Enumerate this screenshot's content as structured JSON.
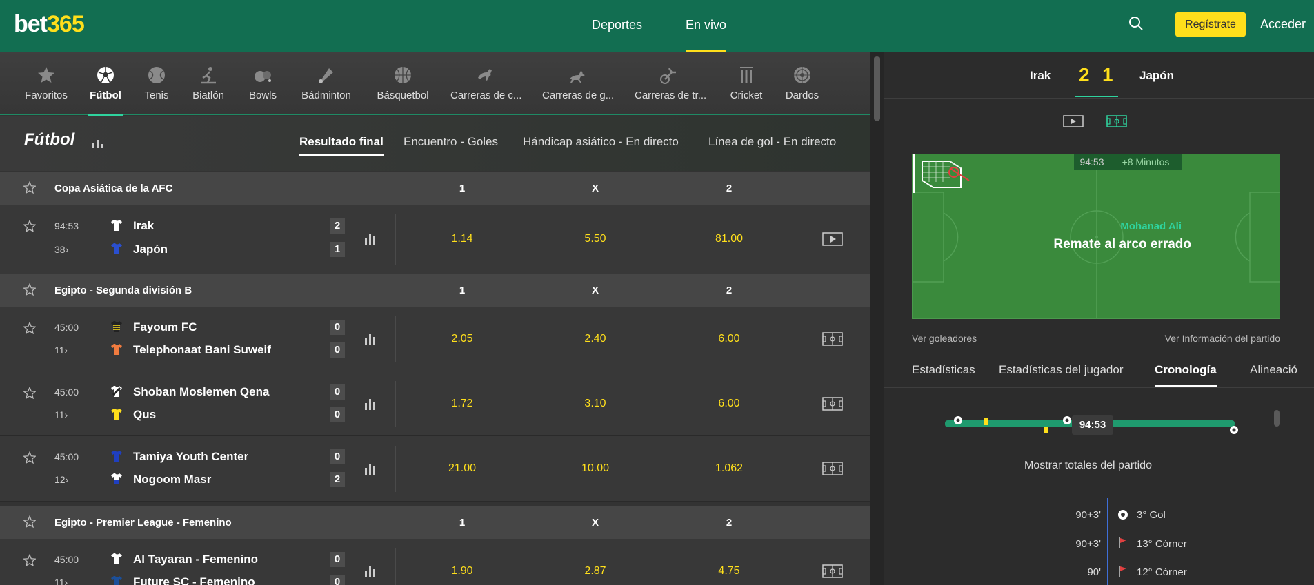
{
  "logo": {
    "part1": "bet",
    "part2": "365"
  },
  "nav": {
    "sports": "Deportes",
    "live": "En vivo"
  },
  "header": {
    "register": "Regístrate",
    "login": "Acceder"
  },
  "sports": [
    {
      "label": "Favoritos",
      "icon": "star-icon"
    },
    {
      "label": "Fútbol",
      "icon": "soccer-ball-icon"
    },
    {
      "label": "Tenis",
      "icon": "tennis-ball-icon"
    },
    {
      "label": "Biatlón",
      "icon": "biathlon-icon"
    },
    {
      "label": "Bowls",
      "icon": "bowls-icon"
    },
    {
      "label": "Bádminton",
      "icon": "shuttlecock-icon"
    },
    {
      "label": "Básquetbol",
      "icon": "basketball-icon"
    },
    {
      "label": "Carreras de c...",
      "icon": "horse-icon"
    },
    {
      "label": "Carreras de g...",
      "icon": "greyhound-icon"
    },
    {
      "label": "Carreras de tr...",
      "icon": "trotting-icon"
    },
    {
      "label": "Cricket",
      "icon": "cricket-stumps-icon"
    },
    {
      "label": "Dardos",
      "icon": "dartboard-icon"
    }
  ],
  "section": {
    "title": "Fútbol",
    "tabs": [
      "Resultado final",
      "Encuentro - Goles",
      "Hándicap asiático - En directo",
      "Línea de gol - En directo"
    ]
  },
  "cols": {
    "c1": "1",
    "cx": "X",
    "c2": "2"
  },
  "competitions": [
    {
      "name": "Copa Asiática de la AFC"
    },
    {
      "name": "Egipto - Segunda división B"
    },
    {
      "name": "Egipto - Premier League - Femenino"
    }
  ],
  "events": [
    {
      "time": "94:53",
      "markets": "38›",
      "home": "Irak",
      "away": "Japón",
      "hs": "2",
      "as": "1",
      "o1": "1.14",
      "ox": "5.50",
      "o2": "81.00",
      "media": "video-icon"
    },
    {
      "time": "45:00",
      "markets": "11›",
      "home": "Fayoum FC",
      "away": "Telephonaat Bani Suweif",
      "hs": "0",
      "as": "0",
      "o1": "2.05",
      "ox": "2.40",
      "o2": "6.00",
      "media": "pitch-icon"
    },
    {
      "time": "45:00",
      "markets": "11›",
      "home": "Shoban Moslemen Qena",
      "away": "Qus",
      "hs": "0",
      "as": "0",
      "o1": "1.72",
      "ox": "3.10",
      "o2": "6.00",
      "media": "pitch-icon"
    },
    {
      "time": "45:00",
      "markets": "12›",
      "home": "Tamiya Youth Center",
      "away": "Nogoom Masr",
      "hs": "0",
      "as": "2",
      "o1": "21.00",
      "ox": "10.00",
      "o2": "1.062",
      "media": "pitch-icon"
    },
    {
      "time": "45:00",
      "markets": "11›",
      "home": "Al Tayaran - Femenino",
      "away": "Future SC - Femenino",
      "hs": "0",
      "as": "0",
      "o1": "1.90",
      "ox": "2.87",
      "o2": "4.75",
      "media": "pitch-icon"
    }
  ],
  "match": {
    "home": "Irak",
    "away": "Japón",
    "hs": "2",
    "as": "1",
    "clock": "94:53",
    "added": "+8 Minutos",
    "player": "Mohanad Ali",
    "action": "Remate al arco errado",
    "scorers_link": "Ver goleadores",
    "info_link": "Ver Información del partido",
    "tabs": [
      "Estadísticas",
      "Estadísticas del jugador",
      "Cronología",
      "Alineació"
    ],
    "timeline_clock": "94:53",
    "show_totals": "Mostrar totales del partido",
    "timeline": [
      {
        "time": "90+3'",
        "text": "3° Gol",
        "icon": "soccer-ball-icon"
      },
      {
        "time": "90+3'",
        "text": "13° Córner",
        "icon": "corner-flag-icon"
      },
      {
        "time": "90'",
        "text": "12° Córner",
        "icon": "corner-flag-icon"
      }
    ]
  },
  "colors": {
    "brand": "#126e51",
    "accent": "#ffdf1b",
    "live": "#2fd39e"
  }
}
